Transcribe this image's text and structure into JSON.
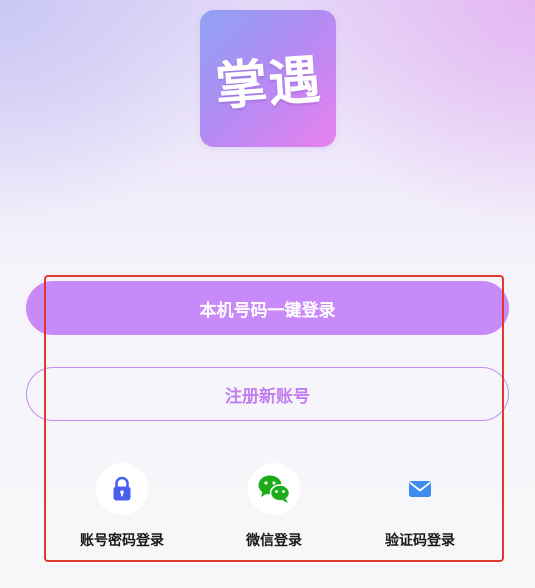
{
  "app": {
    "logo_text": "掌遇"
  },
  "login": {
    "one_click_label": "本机号码一键登录",
    "register_label": "注册新账号"
  },
  "alt_logins": [
    {
      "label": "账号密码登录",
      "icon": "lock-icon",
      "color": "#4a5ef0"
    },
    {
      "label": "微信登录",
      "icon": "wechat-icon",
      "color": "#1aad19"
    },
    {
      "label": "验证码登录",
      "icon": "mail-icon",
      "color": "#3d8cf0"
    }
  ],
  "colors": {
    "primary": "#c88af8",
    "outline": "#c58ef2",
    "highlight": "#e0392f"
  }
}
